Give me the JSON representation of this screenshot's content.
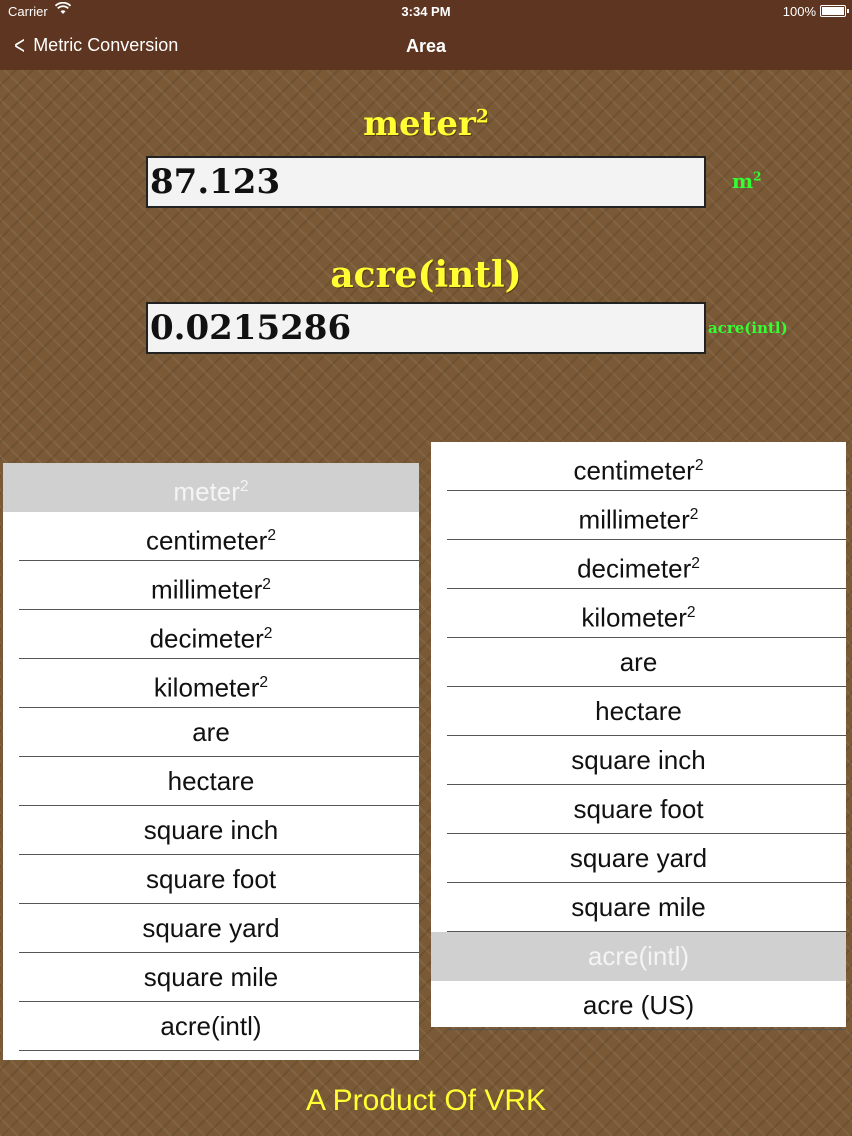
{
  "status_bar": {
    "carrier": "Carrier",
    "time": "3:34 PM",
    "battery": "100%"
  },
  "nav": {
    "back_label": "Metric Conversion",
    "title": "Area"
  },
  "converter": {
    "from": {
      "title": "meter",
      "title_sup": "2",
      "value": "87.123",
      "unit": "m",
      "unit_sup": "2"
    },
    "to": {
      "title": "acre(intl)",
      "value": "0.0215286",
      "unit": "acre(intl)"
    }
  },
  "left_picker": {
    "items": [
      {
        "label": "meter",
        "sup": "2",
        "selected": true
      },
      {
        "label": "centimeter",
        "sup": "2"
      },
      {
        "label": "millimeter",
        "sup": "2"
      },
      {
        "label": "decimeter",
        "sup": "2"
      },
      {
        "label": "kilometer",
        "sup": "2"
      },
      {
        "label": "are",
        "sup": ""
      },
      {
        "label": "hectare",
        "sup": ""
      },
      {
        "label": "square inch",
        "sup": ""
      },
      {
        "label": "square foot",
        "sup": ""
      },
      {
        "label": "square yard",
        "sup": ""
      },
      {
        "label": "square mile",
        "sup": ""
      },
      {
        "label": "acre(intl)",
        "sup": ""
      }
    ]
  },
  "right_picker": {
    "items": [
      {
        "label": "centimeter",
        "sup": "2"
      },
      {
        "label": "millimeter",
        "sup": "2"
      },
      {
        "label": "decimeter",
        "sup": "2"
      },
      {
        "label": "kilometer",
        "sup": "2"
      },
      {
        "label": "are",
        "sup": ""
      },
      {
        "label": "hectare",
        "sup": ""
      },
      {
        "label": "square inch",
        "sup": ""
      },
      {
        "label": "square foot",
        "sup": ""
      },
      {
        "label": "square yard",
        "sup": ""
      },
      {
        "label": "square mile",
        "sup": ""
      },
      {
        "label": "acre(intl)",
        "sup": "",
        "selected": true
      },
      {
        "label": "acre (US)",
        "sup": ""
      }
    ]
  },
  "footer": "A Product Of VRK",
  "colors": {
    "bar": "#5e3520",
    "title_yellow": "#ffff33",
    "unit_green": "#33ff33",
    "background": "#7a5a36"
  }
}
